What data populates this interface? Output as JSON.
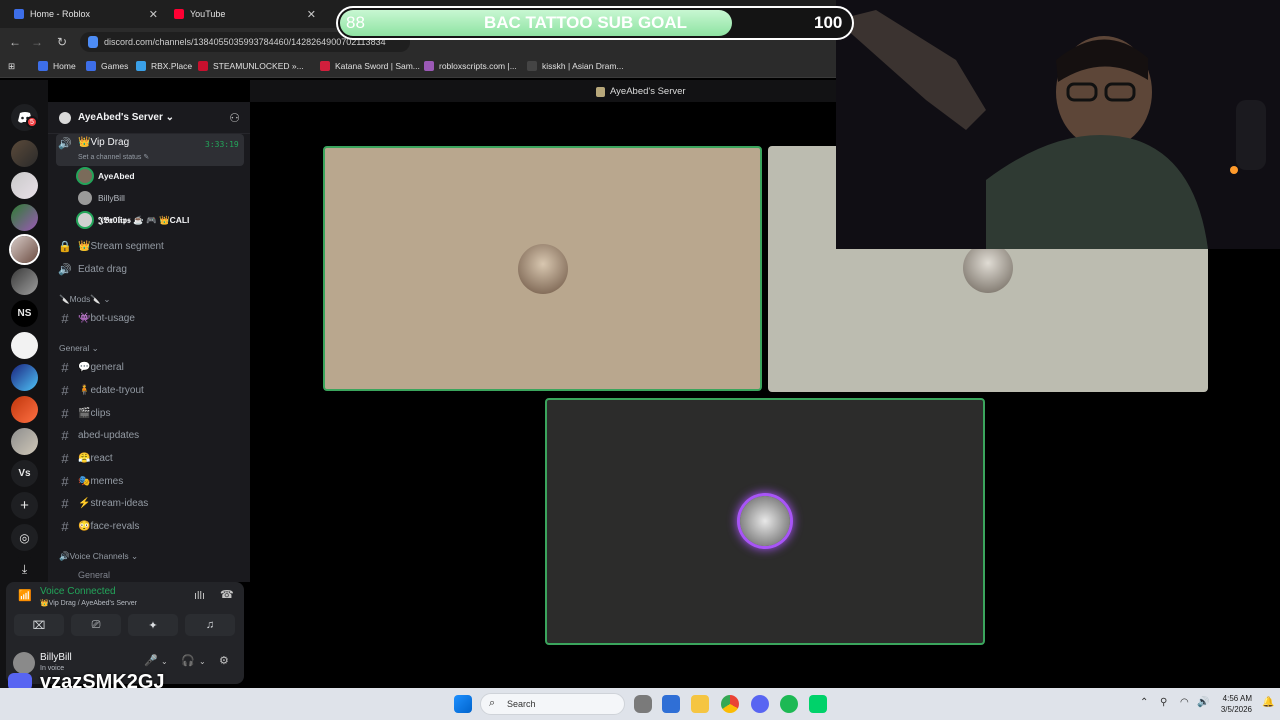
{
  "browser": {
    "tabs": [
      {
        "title": "Home - Roblox"
      },
      {
        "title": "YouTube"
      }
    ],
    "url": "discord.com/channels/1384055035993784460/1428264900702113834",
    "bookmarks": [
      "Home",
      "Games",
      "RBX.Place",
      "STEAMUNLOCKED »...",
      "Katana Sword | Sam...",
      "robloxscripts.com |...",
      "kisskh | Asian Dram..."
    ]
  },
  "overlay": {
    "goal_title": "BAC TATTOO SUB GOAL",
    "goal_current": "88",
    "goal_target": "100",
    "goal_progress": 0.88,
    "watermark": "vzazSMK2GJ"
  },
  "discord": {
    "window_title": "AyeAbed's Server",
    "server_name": "AyeAbed's Server",
    "dm_badge": "5",
    "guild_labels": {
      "ns": "NS",
      "vs": "Vs"
    },
    "voice_channel": {
      "name": "👑Vip Drag",
      "timer": "3:33:19",
      "status": "Set a channel status"
    },
    "voice_users": [
      "AyeAbed",
      "BillyBill",
      "𝕵𝕭𝖝0𝖑𝖎𝖕𝖘 ☕ 🎮 👑CALI"
    ],
    "channels": [
      {
        "prefix": "🔒",
        "name": "👑Stream segment"
      },
      {
        "prefix": "🔊",
        "name": "Edate drag"
      }
    ],
    "cat_mods": "🔪Mods🔪",
    "mods_channels": [
      "👾bot-usage"
    ],
    "cat_general": "General",
    "general_channels": [
      "💬general",
      "🧍edate-tryout",
      "🎬clips",
      "abed-updates",
      "😤react",
      "🎭memes",
      "⚡stream-ideas",
      "😳face-revals"
    ],
    "cat_voice": "🔊Voice Channels",
    "voice_general": "General",
    "panel": {
      "voice_connected": "Voice Connected",
      "voice_location": "👑Vip Drag / AyeAbed's Server",
      "username": "BillyBill",
      "user_status": "In voice"
    }
  },
  "taskbar": {
    "search_placeholder": "Search",
    "time": "4:56 AM",
    "date": "3/5/2026"
  },
  "colors": {
    "voice_green": "#23a55a",
    "speaking_ring": "#3ba55d",
    "purple_ring": "#a855f7"
  }
}
